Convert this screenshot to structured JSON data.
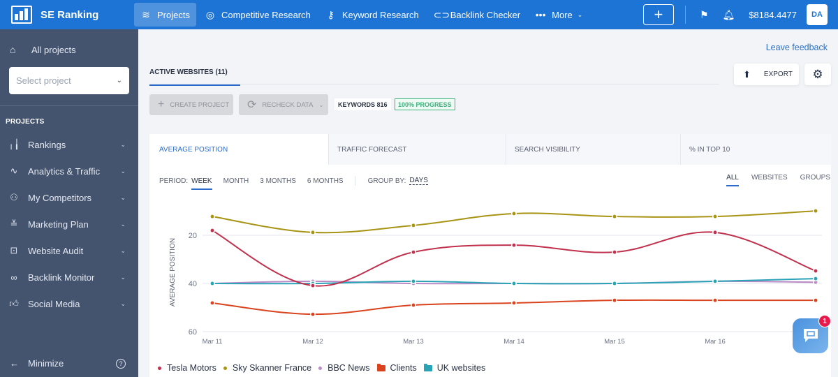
{
  "topbar": {
    "brand": "SE Ranking",
    "nav": [
      {
        "label": "Projects",
        "icon": "layers-icon",
        "active": true
      },
      {
        "label": "Competitive Research",
        "icon": "target-icon",
        "active": false
      },
      {
        "label": "Keyword Research",
        "icon": "key-icon",
        "active": false
      },
      {
        "label": "Backlink Checker",
        "icon": "link-icon",
        "active": false
      },
      {
        "label": "More",
        "icon": "more-dots-icon",
        "active": false
      }
    ],
    "balance": "$8184.4477",
    "avatar_initials": "DA"
  },
  "sidebar": {
    "all_projects": "All projects",
    "select_placeholder": "Select project",
    "section_heading": "PROJECTS",
    "items": [
      {
        "label": "Rankings",
        "icon": "bar-chart-icon"
      },
      {
        "label": "Analytics & Traffic",
        "icon": "pulse-icon"
      },
      {
        "label": "My Competitors",
        "icon": "people-icon"
      },
      {
        "label": "Marketing Plan",
        "icon": "checklist-icon"
      },
      {
        "label": "Website Audit",
        "icon": "audit-icon"
      },
      {
        "label": "Backlink Monitor",
        "icon": "link-icon"
      },
      {
        "label": "Social Media",
        "icon": "thumbs-up-icon"
      }
    ],
    "minimize": "Minimize"
  },
  "main": {
    "feedback_link": "Leave feedback",
    "active_tab": "ACTIVE WEBSITES (11)",
    "export_label": "EXPORT",
    "create_project": "CREATE PROJECT",
    "recheck_data": "RECHECK DATA",
    "keywords_badge": "KEYWORDS 816",
    "progress_badge": "100%  PROGRESS",
    "progress_value": 100,
    "chart_tabs": [
      "AVERAGE POSITION",
      "TRAFFIC FORECAST",
      "SEARCH VISIBILITY",
      "% IN TOP 10"
    ],
    "period_label": "PERIOD:",
    "periods": [
      "WEEK",
      "MONTH",
      "3 MONTHS",
      "6 MONTHS"
    ],
    "active_period": "WEEK",
    "group_by_label": "GROUP BY:",
    "group_by_value": "DAYS",
    "view_options": [
      "ALL",
      "WEBSITES",
      "GROUPS"
    ],
    "active_view": "ALL",
    "chat_unread": "1"
  },
  "chart_data": {
    "type": "line",
    "title": "Average Position",
    "xlabel": "",
    "ylabel": "AVERAGE POSITION",
    "x": [
      "Mar 11",
      "Mar 12",
      "Mar 13",
      "Mar 14",
      "Mar 15",
      "Mar 16",
      "Mar 17"
    ],
    "x_tick_labels": [
      "Mar 11",
      "Mar 12",
      "Mar 13",
      "Mar 14",
      "Mar 15",
      "Mar 16"
    ],
    "y_ticks": [
      20,
      40,
      60
    ],
    "ylim": [
      60,
      12
    ],
    "y_inverted": true,
    "grid": true,
    "legend_position": "bottom-left",
    "series": [
      {
        "name": "Tesla Motors",
        "color": "#c0314d",
        "kind": "website",
        "values": [
          18.0,
          40.9,
          27.0,
          24.1,
          27.0,
          18.8,
          34.8
        ]
      },
      {
        "name": "Sky Skanner France",
        "color": "#a89414",
        "kind": "website",
        "values": [
          12.2,
          18.8,
          15.9,
          11.0,
          12.2,
          12.2,
          9.9
        ]
      },
      {
        "name": "BBC News",
        "color": "#b98ac6",
        "kind": "website",
        "values": [
          40.0,
          39.1,
          40.0,
          40.0,
          40.0,
          39.1,
          39.5
        ]
      },
      {
        "name": "Clients",
        "color": "#d9431e",
        "kind": "group",
        "values": [
          48.1,
          52.8,
          49.0,
          48.1,
          47.0,
          47.0,
          47.0
        ]
      },
      {
        "name": "UK websites",
        "color": "#2ba3b7",
        "kind": "group",
        "values": [
          40.0,
          40.0,
          39.1,
          40.0,
          40.0,
          39.1,
          38.0
        ]
      }
    ]
  }
}
